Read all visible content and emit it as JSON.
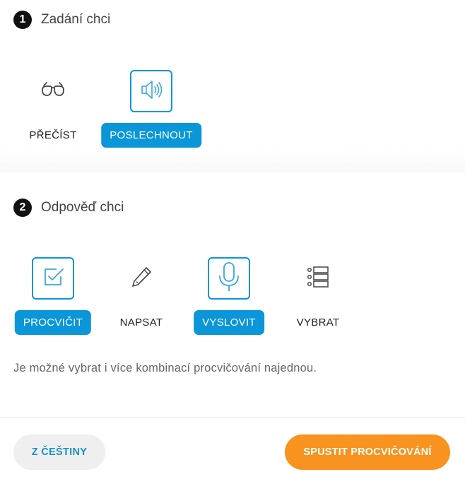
{
  "close_icon_name": "close-icon",
  "section1": {
    "step_number": "1",
    "title": "Zadání chci",
    "options": [
      {
        "label": "PŘEČÍST",
        "icon": "glasses-icon",
        "selected": false
      },
      {
        "label": "POSLECHNOUT",
        "icon": "speaker-icon",
        "selected": true
      }
    ]
  },
  "section2": {
    "step_number": "2",
    "title": "Odpověď chci",
    "options": [
      {
        "label": "PROCVIČIT",
        "icon": "checkbox-icon",
        "selected": true
      },
      {
        "label": "NAPSAT",
        "icon": "pencil-icon",
        "selected": false
      },
      {
        "label": "VYSLOVIT",
        "icon": "microphone-icon",
        "selected": true
      },
      {
        "label": "VYBRAT",
        "icon": "list-icon",
        "selected": false
      }
    ],
    "hint": "Je možné vybrat i více kombinací procvičování najednou."
  },
  "footer": {
    "secondary_button": "Z ČEŠTINY",
    "primary_button": "SPUSTIT PROCVIČOVÁNÍ"
  },
  "colors": {
    "accent_blue": "#0a96d8",
    "primary_orange": "#f7931e",
    "secondary_gray": "#efefef"
  }
}
